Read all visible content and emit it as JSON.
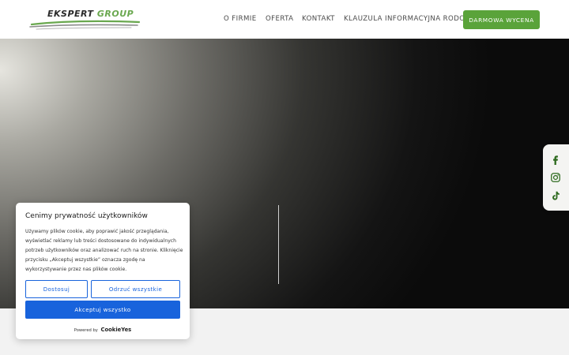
{
  "header": {
    "logo_text_1": "EKSPERT",
    "logo_text_2": "GROUP",
    "nav": [
      "O FIRMIE",
      "OFERTA",
      "KONTAKT",
      "KLAUZULA INFORMACYJNA RODO"
    ],
    "cta_label": "DARMOWA WYCENA"
  },
  "social": {
    "icons": [
      "facebook-icon",
      "instagram-icon",
      "tiktok-icon"
    ],
    "color": "#2e6b1f"
  },
  "cookie": {
    "title": "Cenimy prywatność użytkowników",
    "body": "Używamy plików cookie, aby poprawić jakość przeglądania, wyświetlać reklamy lub treści dostosowane do indywidualnych potrzeb użytkowników oraz analizować ruch na stronie. Kliknięcie przycisku „Akceptuj wszystkie” oznacza zgodę na wykorzystywanie przez nas plików cookie.",
    "customize_label": "Dostosuj",
    "reject_label": "Odrzuć wszystkie",
    "accept_label": "Akceptuj wszystko",
    "powered_by": "Powered by",
    "powered_brand": "CookieYes"
  },
  "colors": {
    "brand_green": "#5aa33a",
    "cookie_blue": "#1863dc"
  }
}
